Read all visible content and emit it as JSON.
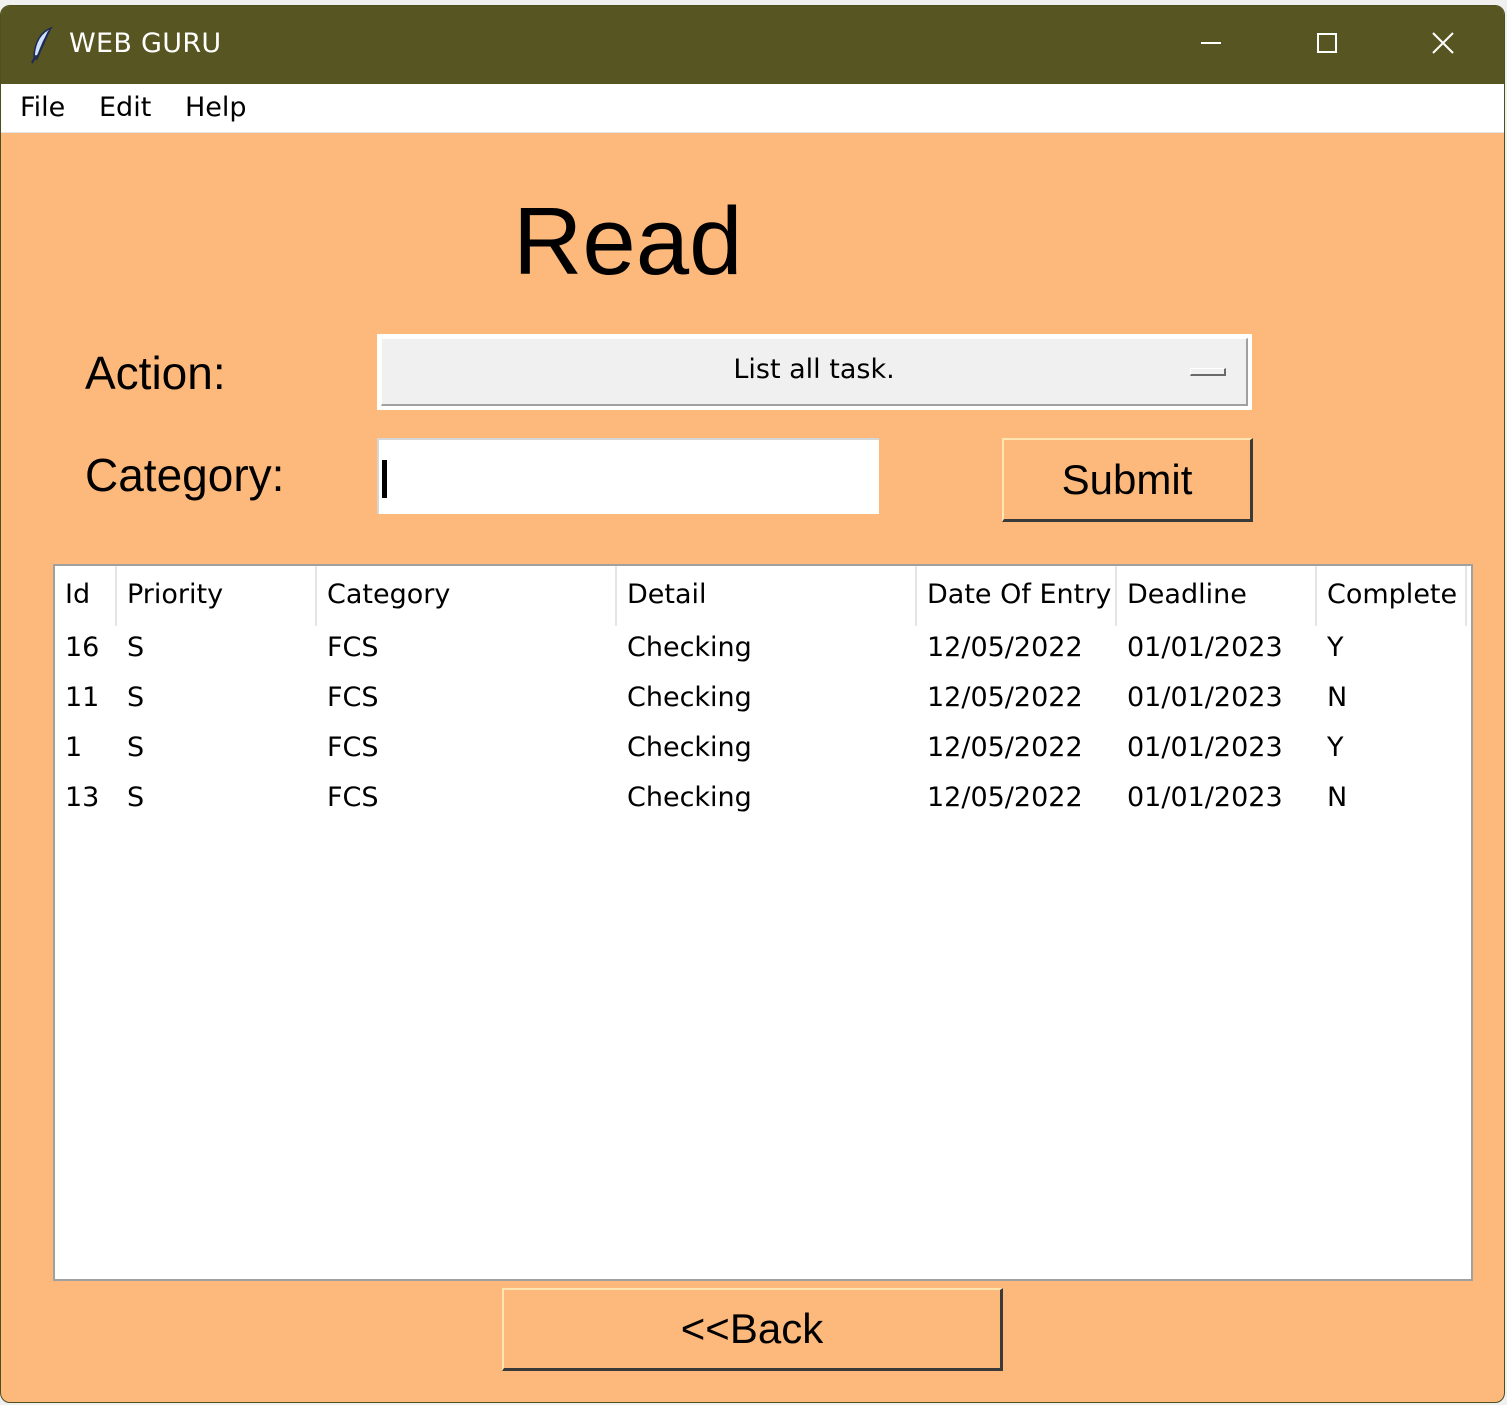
{
  "window": {
    "title": "WEB GURU"
  },
  "menu": {
    "items": [
      "File",
      "Edit",
      "Help"
    ]
  },
  "page": {
    "heading": "Read",
    "action_label": "Action:",
    "action_value": "List all task.",
    "category_label": "Category:",
    "category_value": "",
    "submit_label": "Submit",
    "back_label": "<<Back"
  },
  "table": {
    "columns": [
      "Id",
      "Priority",
      "Category",
      "Detail",
      "Date Of Entry",
      "Deadline",
      "Complete"
    ],
    "rows": [
      [
        "16",
        "S",
        "FCS",
        "Checking",
        "12/05/2022",
        "01/01/2023",
        "Y"
      ],
      [
        "11",
        "S",
        "FCS",
        "Checking",
        "12/05/2022",
        "01/01/2023",
        "N"
      ],
      [
        "1",
        "S",
        "FCS",
        "Checking",
        "12/05/2022",
        "01/01/2023",
        "Y"
      ],
      [
        "13",
        "S",
        "FCS",
        "Checking",
        "12/05/2022",
        "01/01/2023",
        "N"
      ]
    ]
  },
  "colors": {
    "titlebar": "#575521",
    "background": "#fdb97c",
    "menubar": "#ffffff"
  },
  "icons": {
    "app": "feather-icon",
    "minimize": "minimize-icon",
    "maximize": "maximize-icon",
    "close": "close-icon",
    "dropdown": "option-menu-indicator-icon"
  }
}
